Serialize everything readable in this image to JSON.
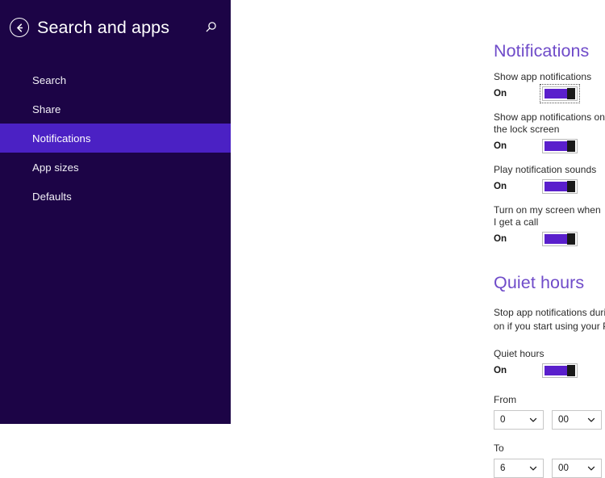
{
  "sidebar": {
    "back_icon": "back-arrow-icon",
    "title": "Search and apps",
    "search_icon": "search-icon",
    "items": [
      {
        "label": "Search",
        "selected": false
      },
      {
        "label": "Share",
        "selected": false
      },
      {
        "label": "Notifications",
        "selected": true
      },
      {
        "label": "App sizes",
        "selected": false
      },
      {
        "label": "Defaults",
        "selected": false
      }
    ]
  },
  "main": {
    "notifications": {
      "title": "Notifications",
      "settings": [
        {
          "label": "Show app notifications",
          "state": "On",
          "focused": true
        },
        {
          "label": "Show app notifications on the lock screen",
          "state": "On",
          "focused": false
        },
        {
          "label": "Play notification sounds",
          "state": "On",
          "focused": false
        },
        {
          "label": "Turn on my screen when I get a call",
          "state": "On",
          "focused": false
        }
      ]
    },
    "quiet_hours": {
      "title": "Quiet hours",
      "description": "Stop app notifications during certain hours of the day. Notifications turn back on if you start using your PC or when quiet hours end.",
      "toggle": {
        "label": "Quiet hours",
        "state": "On"
      },
      "from": {
        "label": "From",
        "hour": "0",
        "minute": "00"
      },
      "to": {
        "label": "To",
        "hour": "6",
        "minute": "00"
      }
    }
  },
  "colors": {
    "sidebar_bg": "#1c0446",
    "sidebar_selected": "#4b21c4",
    "accent_heading": "#6f4bc9",
    "toggle_fill": "#5a1fcc",
    "toggle_thumb": "#1a1a1a"
  }
}
